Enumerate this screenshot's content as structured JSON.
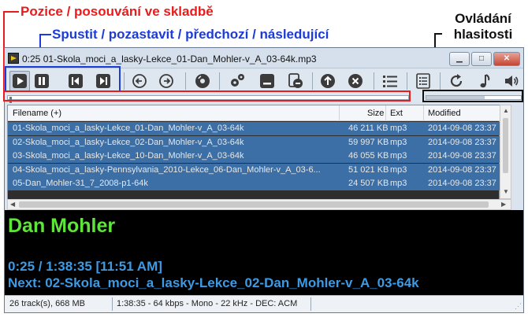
{
  "annotations": {
    "seek": "Pozice / posouvání ve skladbě",
    "playback": "Spustit / pozastavit / předchozí / následující",
    "volume_line1": "Ovládání",
    "volume_line2": "hlasitosti"
  },
  "window": {
    "title": "0:25 01-Skola_moci_a_lasky-Lekce_01-Dan_Mohler-v_A_03-64k.mp3",
    "minimize": "▁",
    "maximize": "□",
    "close": "✕"
  },
  "toolbar": {
    "icons": [
      "play-icon",
      "pause-icon",
      "previous-icon",
      "next-icon",
      "back-icon",
      "forward-icon",
      "disc-icon",
      "settings-icon",
      "minimize-panel-icon",
      "remove-icon",
      "up-icon",
      "stop-icon",
      "list-icon",
      "playlist-icon",
      "repeat-icon",
      "note-icon",
      "volume-icon"
    ]
  },
  "seek": {
    "progress": 0.003
  },
  "volume": {
    "level": 0.62
  },
  "playlist": {
    "columns": {
      "filename": "Filename (+)",
      "size": "Size",
      "ext": "Ext",
      "modified": "Modified"
    },
    "rows": [
      {
        "filename": "01-Skola_moci_a_lasky-Lekce_01-Dan_Mohler-v_A_03-64k",
        "size": "46 211 KB",
        "ext": "mp3",
        "modified": "2014-09-08 23:37"
      },
      {
        "filename": "02-Skola_moci_a_lasky-Lekce_02-Dan_Mohler-v_A_03-64k",
        "size": "59 997 KB",
        "ext": "mp3",
        "modified": "2014-09-08 23:37"
      },
      {
        "filename": "03-Skola_moci_a_lasky-Lekce_10-Dan_Mohler-v_A_03-64k",
        "size": "46 055 KB",
        "ext": "mp3",
        "modified": "2014-09-08 23:37"
      },
      {
        "filename": "04-Skola_moci_a_lasky-Pennsylvania_2010-Lekce_06-Dan_Mohler-v_A_03-6...",
        "size": "51 021 KB",
        "ext": "mp3",
        "modified": "2014-09-08 23:37"
      },
      {
        "filename": "05-Dan_Mohler-31_7_2008-p1-64k",
        "size": "24 507 KB",
        "ext": "mp3",
        "modified": "2014-09-08 23:37"
      }
    ]
  },
  "info": {
    "artist": "Dan Mohler",
    "time": "0:25 / 1:38:35   [11:51 AM]",
    "next": "Next: 02-Skola_moci_a_lasky-Lekce_02-Dan_Mohler-v_A_03-64k"
  },
  "status": {
    "tracks": "26 track(s), 668 MB",
    "format": "1:38:35 - 64 kbps - Mono - 22 kHz - DEC: ACM"
  },
  "colors": {
    "annotation_red": "#e81c1c",
    "annotation_blue": "#1d3bd6",
    "artist": "#5fe43a",
    "info": "#3d9ae4",
    "selection": "#3c6fa6"
  }
}
